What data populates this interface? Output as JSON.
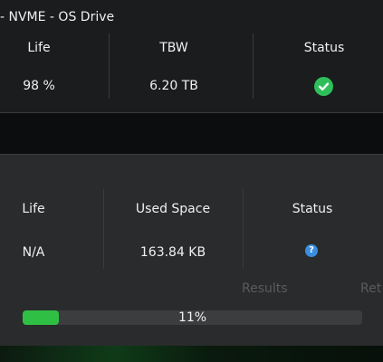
{
  "top_card": {
    "title": "- NVME - OS Drive",
    "headers": {
      "life": "Life",
      "tbw": "TBW",
      "status": "Status"
    },
    "values": {
      "life": "98 %",
      "tbw": "6.20 TB"
    },
    "status_icon": "check-circle-icon"
  },
  "bottom_card": {
    "headers": {
      "life": "Life",
      "used_space": "Used Space",
      "status": "Status"
    },
    "values": {
      "life": "N/A",
      "used_space": "163.84 KB",
      "help_glyph": "?"
    },
    "status_icon": "help-circle-icon",
    "muted_labels": {
      "results": "Results",
      "ret": "Ret"
    },
    "progress": {
      "percent": 11,
      "label": "11%"
    }
  },
  "colors": {
    "success": "#2fbf5a",
    "progress": "#2fbf44",
    "info": "#3a8ee0"
  }
}
